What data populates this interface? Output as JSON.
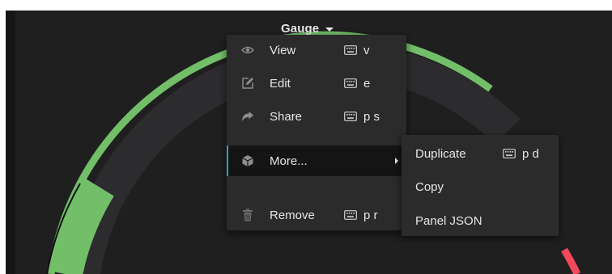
{
  "panel": {
    "title": "Gauge",
    "gauge_colors": {
      "threshold_green": "#73bf69",
      "threshold_red": "#f2495c",
      "value_green": "#73bf69",
      "track": "#2c2c2e",
      "background": "#1f1f20"
    }
  },
  "menu": {
    "items": [
      {
        "label": "View",
        "icon": "eye-icon",
        "shortcut": "v"
      },
      {
        "label": "Edit",
        "icon": "edit-icon",
        "shortcut": "e"
      },
      {
        "label": "Share",
        "icon": "share-icon",
        "shortcut": "p s"
      },
      {
        "label": "More...",
        "icon": "cube-icon",
        "shortcut": ""
      },
      {
        "label": "Remove",
        "icon": "trash-icon",
        "shortcut": "p r"
      }
    ],
    "submenu": [
      {
        "label": "Duplicate",
        "shortcut": "p d"
      },
      {
        "label": "Copy",
        "shortcut": ""
      },
      {
        "label": "Panel JSON",
        "shortcut": ""
      }
    ],
    "colors": {
      "background": "#2b2b2c",
      "active_background": "#141414",
      "active_border": "#33a2a2",
      "icon": "#8e8e8e"
    }
  }
}
